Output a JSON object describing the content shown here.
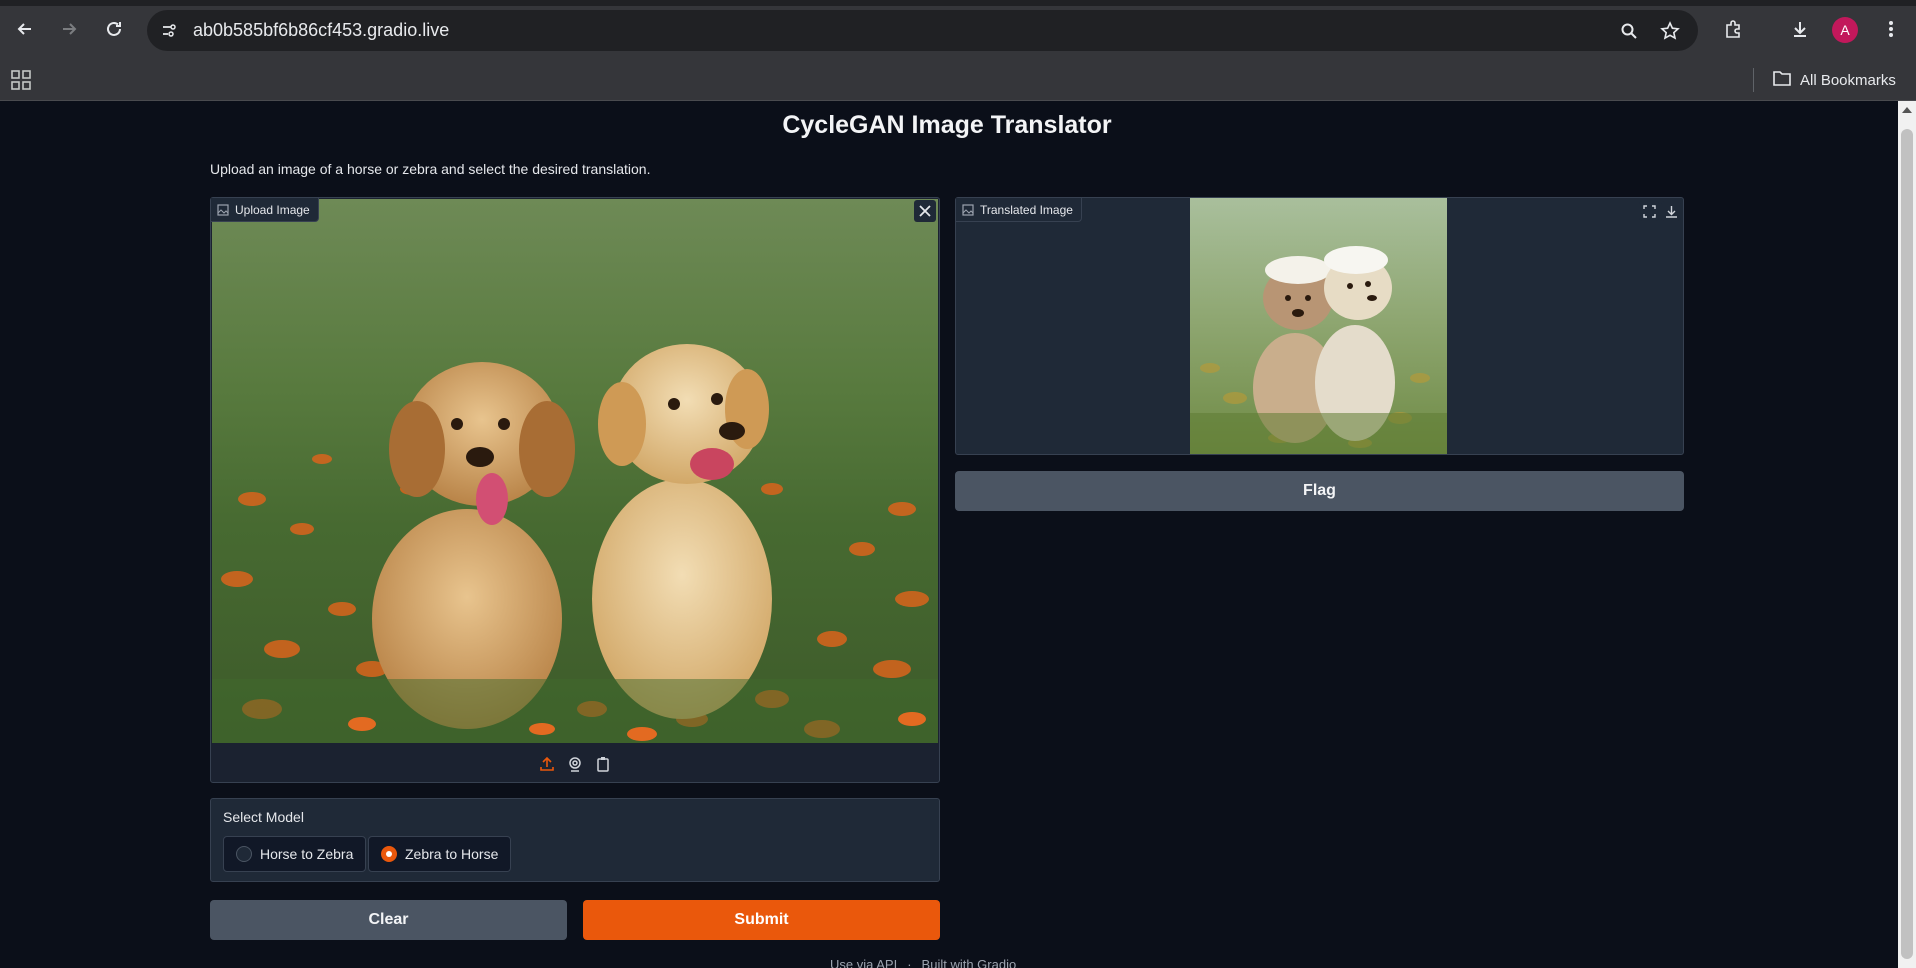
{
  "browser": {
    "url": "ab0b585bf6b86cf453.gradio.live",
    "avatar_letter": "A",
    "bookmarks_label": "All Bookmarks",
    "icons": [
      "back-icon",
      "forward-icon",
      "reload-icon",
      "site-info-icon",
      "zoom-icon",
      "star-icon",
      "extensions-icon",
      "download-icon",
      "more-icon",
      "apps-icon",
      "folder-icon"
    ]
  },
  "app": {
    "title": "CycleGAN Image Translator",
    "description": "Upload an image of a horse or zebra and select the desired translation.",
    "upload": {
      "label": "Upload Image",
      "sources": [
        "upload-icon",
        "webcam-icon",
        "clipboard-icon"
      ]
    },
    "model": {
      "label": "Select Model",
      "options": [
        "Horse to Zebra",
        "Zebra to Horse"
      ],
      "selected": "Zebra to Horse"
    },
    "buttons": {
      "clear": "Clear",
      "submit": "Submit",
      "flag": "Flag"
    },
    "output": {
      "label": "Translated Image"
    },
    "footer": {
      "api": "Use via API",
      "sep": "·",
      "built": "Built with Gradio"
    }
  },
  "colors": {
    "accent": "#ea580c",
    "background": "#0b0f19",
    "panel": "#1f2937"
  }
}
